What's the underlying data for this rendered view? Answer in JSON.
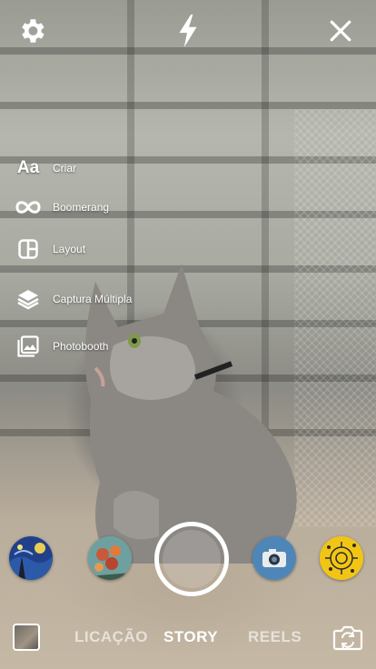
{
  "top_bar": {
    "settings_icon": "gear-icon",
    "flash_icon": "lightning-icon",
    "close_icon": "close-icon"
  },
  "side_menu": {
    "items": [
      {
        "icon": "text-aa-icon",
        "icon_text": "Aa",
        "label": "Criar"
      },
      {
        "icon": "infinity-icon",
        "label": "Boomerang"
      },
      {
        "icon": "layout-grid-icon",
        "label": "Layout"
      },
      {
        "icon": "layers-icon",
        "label": "Captura Múltipla"
      },
      {
        "icon": "photo-icon",
        "label": "Photobooth"
      }
    ]
  },
  "filters": [
    {
      "name": "starry-night-filter"
    },
    {
      "name": "floral-painting-filter"
    },
    {
      "name": "shutter"
    },
    {
      "name": "vintage-camera-filter"
    },
    {
      "name": "yellow-pattern-filter"
    }
  ],
  "bottom_bar": {
    "modes": [
      "LICAÇÃO",
      "STORY",
      "REELS"
    ],
    "active_mode": "STORY",
    "flip_icon": "camera-flip-icon"
  },
  "colors": {
    "text": "#ffffff",
    "inactive_mode": "rgba(255,255,255,0.6)"
  }
}
